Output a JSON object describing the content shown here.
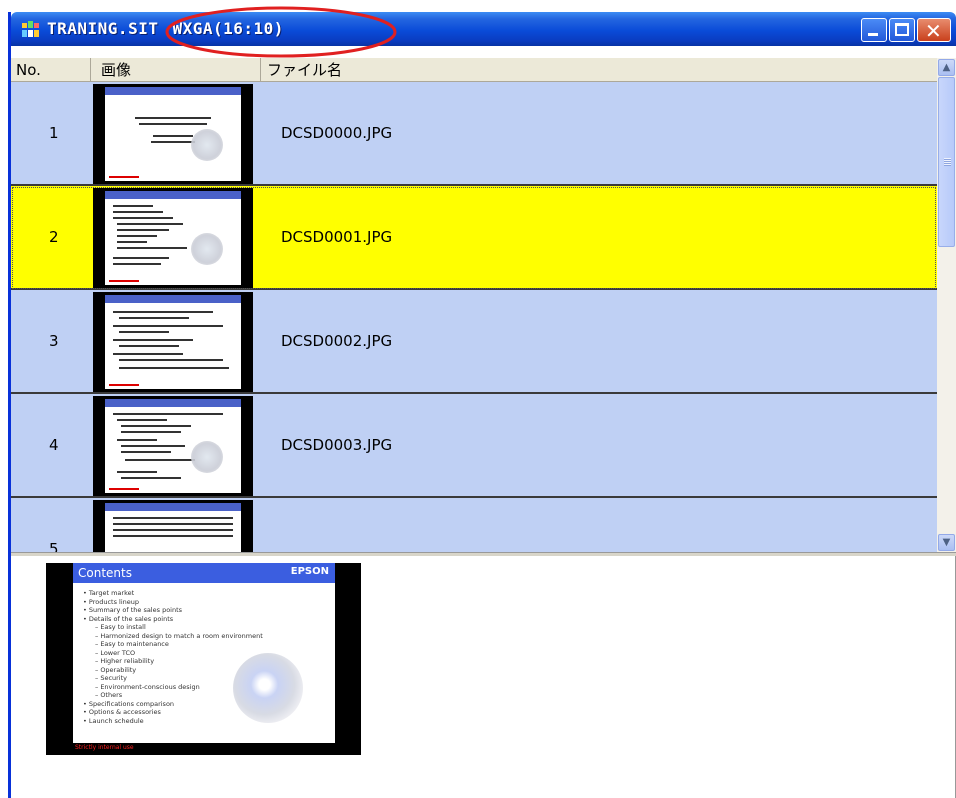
{
  "window": {
    "filename": "TRANING.SIT",
    "resolution": "WXGA(16:10)"
  },
  "columns": {
    "no": "No.",
    "image": "画像",
    "filename": "ファイル名"
  },
  "rows": [
    {
      "no": "1",
      "file": "DCSD0000.JPG",
      "selected": false
    },
    {
      "no": "2",
      "file": "DCSD0001.JPG",
      "selected": true
    },
    {
      "no": "3",
      "file": "DCSD0002.JPG",
      "selected": false
    },
    {
      "no": "4",
      "file": "DCSD0003.JPG",
      "selected": false
    },
    {
      "no": "5",
      "file": "",
      "selected": false
    }
  ],
  "preview": {
    "title": "Contents",
    "logo": "EPSON",
    "items": [
      {
        "level": "top",
        "text": "• Target market"
      },
      {
        "level": "top",
        "text": "• Products lineup"
      },
      {
        "level": "top",
        "text": "• Summary of the sales points"
      },
      {
        "level": "top",
        "text": "• Details of the sales points"
      },
      {
        "level": "sub",
        "text": "– Easy to install"
      },
      {
        "level": "sub",
        "text": "– Harmonized design to match a room environment"
      },
      {
        "level": "sub",
        "text": "– Easy to maintenance"
      },
      {
        "level": "sub",
        "text": "– Lower TCO"
      },
      {
        "level": "sub",
        "text": "– Higher reliability"
      },
      {
        "level": "sub",
        "text": "– Operability"
      },
      {
        "level": "sub",
        "text": "– Security"
      },
      {
        "level": "sub",
        "text": "– Environment-conscious design"
      },
      {
        "level": "sub",
        "text": "– Others"
      },
      {
        "level": "top",
        "text": "• Specifications comparison"
      },
      {
        "level": "top",
        "text": "• Options & accessories"
      },
      {
        "level": "top",
        "text": "• Launch schedule"
      }
    ],
    "footer": "Strictly internal use"
  },
  "colors": {
    "selected_row": "#ffff00",
    "row_bg": "#bfd0f4",
    "annotation": "#e02020"
  },
  "icons": {
    "app": "app-icon",
    "minimize": "minimize-icon",
    "maximize": "maximize-icon",
    "close": "close-icon"
  }
}
